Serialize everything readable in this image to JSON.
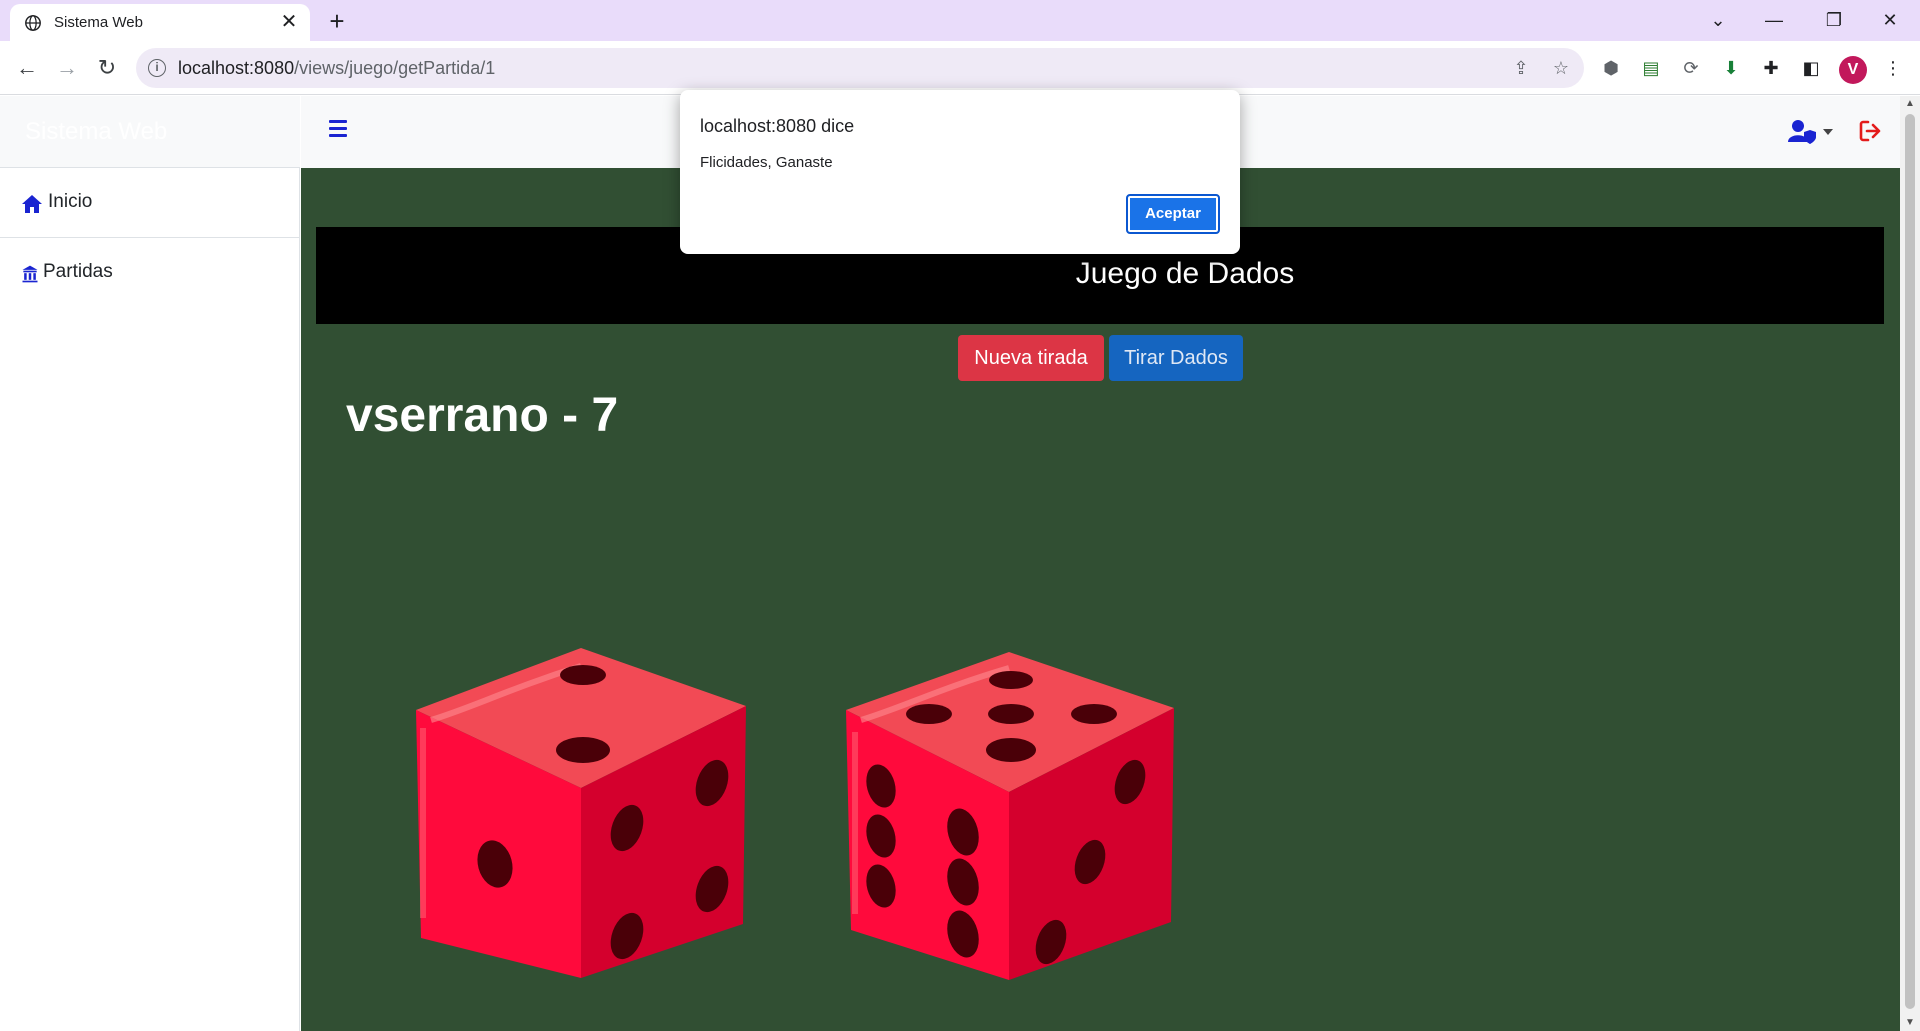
{
  "browser": {
    "tab_title": "Sistema Web",
    "url_host": "localhost:8080",
    "url_path": "/views/juego/getPartida/1",
    "profile_initial": "V"
  },
  "sidebar": {
    "brand": "Sistema Web",
    "items": [
      {
        "label": "Inicio",
        "icon": "home-icon"
      },
      {
        "label": "Partidas",
        "icon": "building-icon"
      }
    ]
  },
  "game": {
    "header_title": "Juego de Dados",
    "new_roll_label": "Nueva tirada",
    "roll_dice_label": "Tirar Dados",
    "player_score": "vserrano - 7",
    "dice": [
      {
        "top_face": 2,
        "left_face": 1,
        "right_face": 4
      },
      {
        "top_face": 5,
        "left_face": 6,
        "right_face": 3
      }
    ]
  },
  "dialog": {
    "title": "localhost:8080 dice",
    "message": "Flicidades, Ganaste",
    "ok_label": "Aceptar"
  },
  "colors": {
    "content_bg": "#314f33",
    "danger": "#dc3545",
    "primary": "#1565c0",
    "die_red": "#ff0033"
  }
}
